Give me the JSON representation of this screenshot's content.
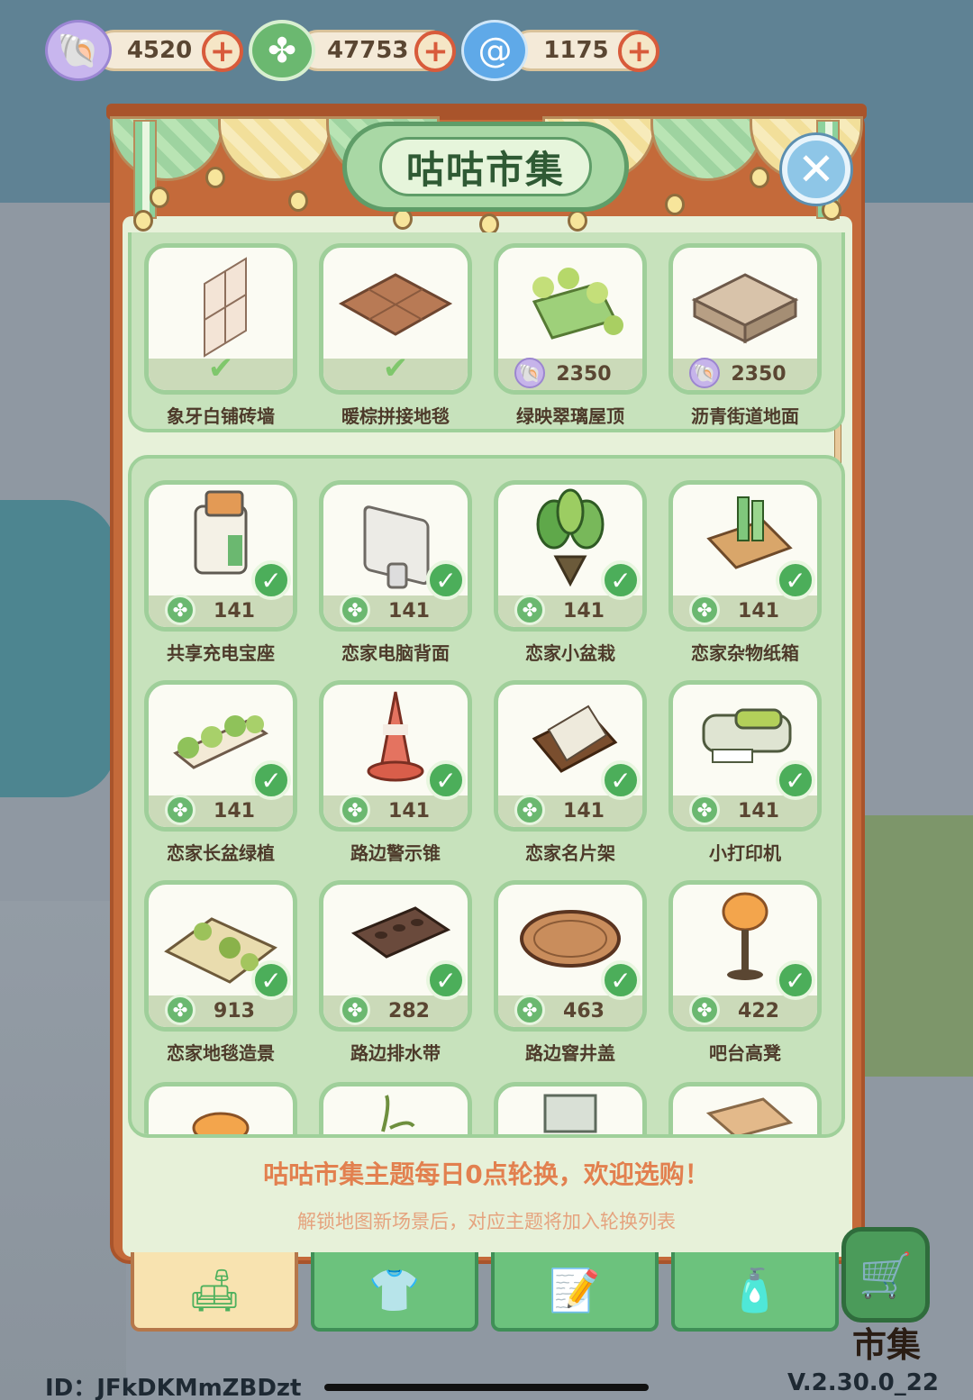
{
  "currencies": [
    {
      "icon": "shell-icon",
      "value": "4520"
    },
    {
      "icon": "clover-coin-icon",
      "value": "47753"
    },
    {
      "icon": "swirl-gem-icon",
      "value": "1175"
    }
  ],
  "header": {
    "title": "咕咕市集"
  },
  "featured": [
    {
      "name": "象牙白铺砖墙",
      "owned": true,
      "price": "",
      "currency": ""
    },
    {
      "name": "暖棕拼接地毯",
      "owned": true,
      "price": "",
      "currency": ""
    },
    {
      "name": "绿映翠璃屋顶",
      "owned": false,
      "price": "2350",
      "currency": "shell"
    },
    {
      "name": "沥青街道地面",
      "owned": false,
      "price": "2350",
      "currency": "shell"
    }
  ],
  "items": [
    {
      "name": "共享充电宝座",
      "price": "141",
      "owned": true
    },
    {
      "name": "恋家电脑背面",
      "price": "141",
      "owned": true
    },
    {
      "name": "恋家小盆栽",
      "price": "141",
      "owned": true
    },
    {
      "name": "恋家杂物纸箱",
      "price": "141",
      "owned": true
    },
    {
      "name": "恋家长盆绿植",
      "price": "141",
      "owned": true
    },
    {
      "name": "路边警示锥",
      "price": "141",
      "owned": true
    },
    {
      "name": "恋家名片架",
      "price": "141",
      "owned": true
    },
    {
      "name": "小打印机",
      "price": "141",
      "owned": true
    },
    {
      "name": "恋家地毯造景",
      "price": "913",
      "owned": true
    },
    {
      "name": "路边排水带",
      "price": "282",
      "owned": true
    },
    {
      "name": "路边窨井盖",
      "price": "463",
      "owned": true
    },
    {
      "name": "吧台高凳",
      "price": "422",
      "owned": true
    }
  ],
  "notice": {
    "primary": "咕咕市集主题每日0点轮换，欢迎选购！",
    "secondary": "解锁地图新场景后，对应主题将加入轮换列表"
  },
  "tabs": [
    {
      "icon": "sofa-icon",
      "active": true
    },
    {
      "icon": "shirt-icon",
      "active": false
    },
    {
      "icon": "notepad-icon",
      "active": false
    },
    {
      "icon": "spray-bottle-icon",
      "active": false
    }
  ],
  "market_button": {
    "icon": "shopping-cart-icon",
    "label": "市集"
  },
  "footer": {
    "id": "ID：JFkDKMmZBDzt",
    "version": "V.2.30.0_22"
  },
  "colors": {
    "accent_green": "#4cae5a",
    "notice_orange": "#e2804f",
    "panel_brown": "#c46a3a"
  }
}
